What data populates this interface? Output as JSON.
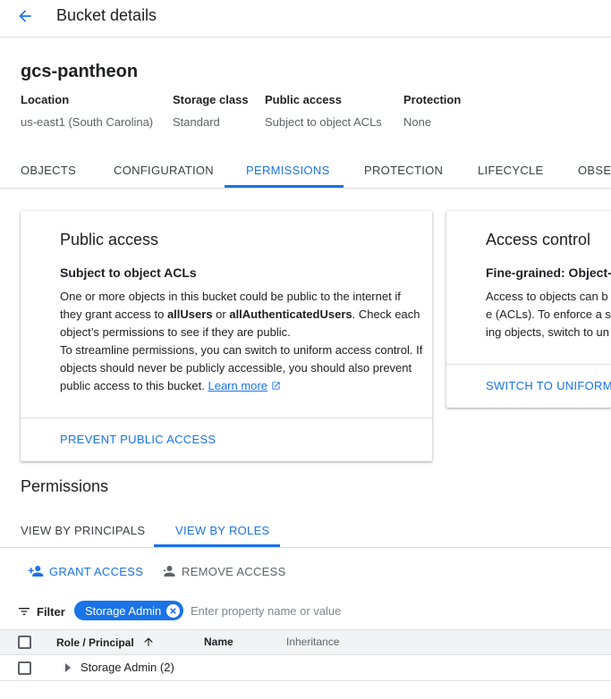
{
  "header": {
    "title": "Bucket details",
    "back_icon": "arrow-back-icon"
  },
  "bucket": {
    "name": "gcs-pantheon",
    "meta": [
      {
        "label": "Location",
        "value": "us-east1 (South Carolina)"
      },
      {
        "label": "Storage class",
        "value": "Standard"
      },
      {
        "label": "Public access",
        "value": "Subject to object ACLs"
      },
      {
        "label": "Protection",
        "value": "None"
      }
    ]
  },
  "tabs": [
    {
      "label": "OBJECTS"
    },
    {
      "label": "CONFIGURATION"
    },
    {
      "label": "PERMISSIONS",
      "active": true
    },
    {
      "label": "PROTECTION"
    },
    {
      "label": "LIFECYCLE"
    },
    {
      "label": "OBSERVABILITY"
    }
  ],
  "public_access_card": {
    "title": "Public access",
    "subtitle": "Subject to object ACLs",
    "body_1a": "One or more objects in this bucket could be public to the internet if they grant access to ",
    "body_1b": "allUsers",
    "body_1c": " or ",
    "body_1d": "allAuthenticatedUsers",
    "body_1e": ". Check each object’s permissions to see if they are public.",
    "body_2": "To streamline permissions, you can switch to uniform access control. If objects should never be publicly accessible, you should also prevent public access to this bucket. ",
    "learn_more": "Learn more",
    "action": "PREVENT PUBLIC ACCESS"
  },
  "access_control_card": {
    "title": "Access control",
    "subtitle": "Fine-grained: Object-",
    "body": "Access to objects can be (ACLs). To enforce a sing objects, switch to unifor",
    "action": "SWITCH TO UNIFORM"
  },
  "permissions": {
    "title": "Permissions",
    "view_tabs": [
      {
        "label": "VIEW BY PRINCIPALS"
      },
      {
        "label": "VIEW BY ROLES",
        "active": true
      }
    ],
    "grant_label": "GRANT ACCESS",
    "remove_label": "REMOVE ACCESS",
    "filter_label": "Filter",
    "filter_chip": "Storage Admin",
    "filter_placeholder": "Enter property name or value",
    "columns": [
      "Role / Principal",
      "Name",
      "Inheritance"
    ],
    "rows": [
      {
        "label": "Storage Admin (2)"
      }
    ]
  },
  "colors": {
    "accent": "#1a73e8",
    "text": "#202124",
    "muted": "#5f6368"
  }
}
